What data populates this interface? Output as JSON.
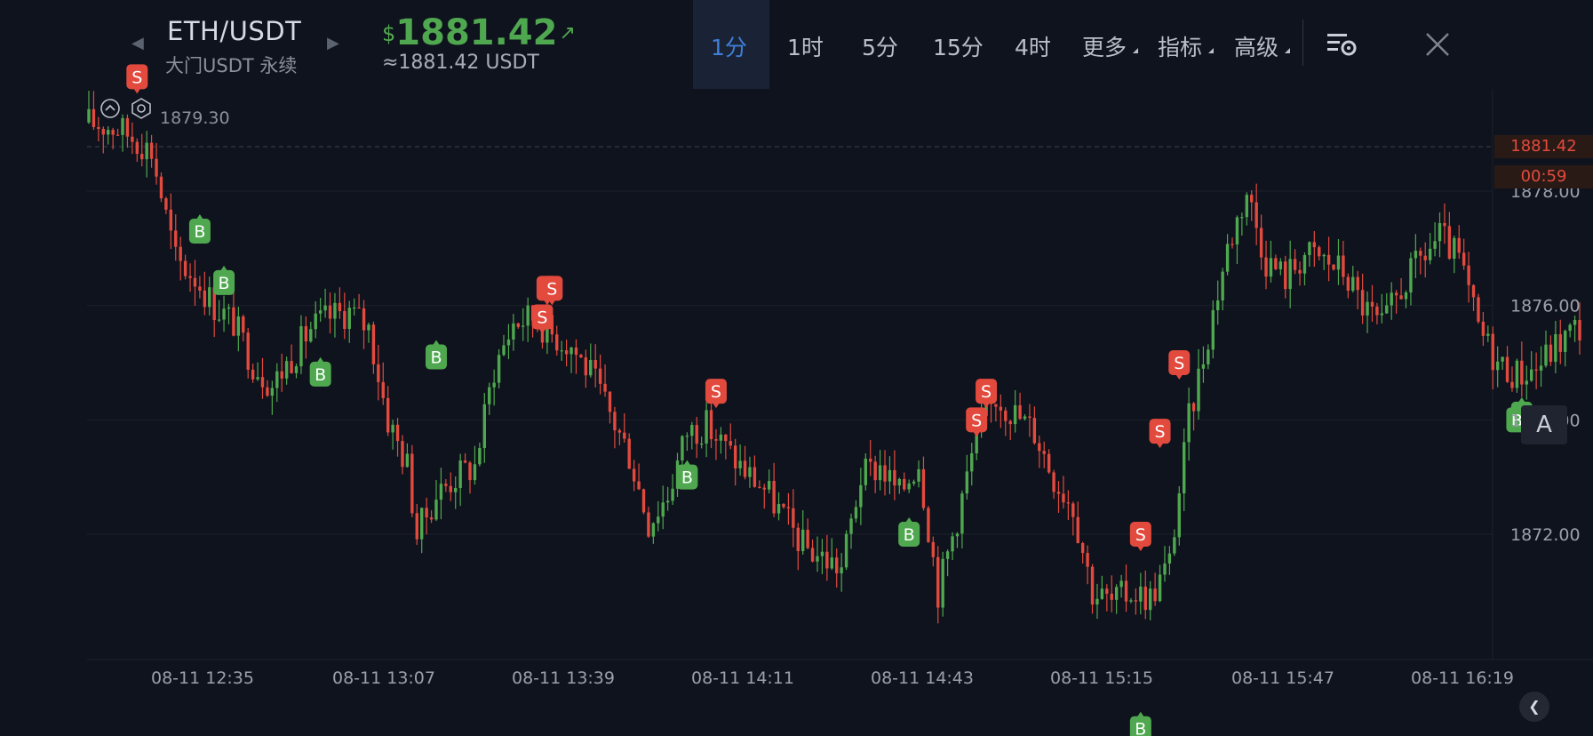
{
  "header": {
    "symbol": "ETH/USDT",
    "subtitle": "大门USDT 永续",
    "price_currency": "$",
    "price": "1881.42",
    "price_arrow": "↗",
    "price_sub": "≈1881.42 USDT",
    "timeframes": [
      "1分",
      "1时",
      "5分",
      "15分",
      "4时",
      "更多",
      "指标",
      "高级"
    ],
    "active_timeframe": "1分"
  },
  "price_label": "1881.42",
  "countdown_label": "00:59",
  "low_label": "1879.30",
  "a_button": "A",
  "back_button": "❮",
  "colors": {
    "up": "#4fa84f",
    "down": "#e24a3e",
    "background": "#0f131d",
    "accent": "#3f7fd8"
  },
  "icons": [
    "chevron-left-icon",
    "chevron-right-icon",
    "settings-list-icon",
    "close-icon",
    "collapse-icon",
    "eye-icon"
  ],
  "chart_data": {
    "type": "candlestick",
    "y_ticks": [
      "1878.00",
      "1876.00",
      "1874.00",
      "1872.00"
    ],
    "x_ticks": [
      "08-11 12:35",
      "08-11 13:07",
      "08-11 13:39",
      "08-11 14:11",
      "08-11 14:43",
      "08-11 15:15",
      "08-11 15:47",
      "08-11 16:19"
    ],
    "ylim": [
      1867.8,
      1880.2
    ],
    "current_price": 1881.42,
    "grid": "horizontal",
    "close_path": [
      [
        0,
        1879.2
      ],
      [
        6,
        1879.1
      ],
      [
        10,
        1878.9
      ],
      [
        13,
        1878.7
      ],
      [
        18,
        1876.8
      ],
      [
        22,
        1876.5
      ],
      [
        26,
        1876.0
      ],
      [
        30,
        1875.7
      ],
      [
        34,
        1875.0
      ],
      [
        38,
        1874.6
      ],
      [
        42,
        1875.1
      ],
      [
        46,
        1875.6
      ],
      [
        50,
        1875.8
      ],
      [
        54,
        1875.9
      ],
      [
        58,
        1875.6
      ],
      [
        62,
        1874.0
      ],
      [
        66,
        1873.2
      ],
      [
        68,
        1872.0
      ],
      [
        72,
        1872.7
      ],
      [
        76,
        1873.0
      ],
      [
        80,
        1873.2
      ],
      [
        84,
        1874.9
      ],
      [
        88,
        1875.7
      ],
      [
        92,
        1875.8
      ],
      [
        96,
        1875.5
      ],
      [
        100,
        1875.3
      ],
      [
        104,
        1874.8
      ],
      [
        108,
        1874.1
      ],
      [
        112,
        1873.4
      ],
      [
        116,
        1872.2
      ],
      [
        120,
        1872.7
      ],
      [
        124,
        1873.8
      ],
      [
        128,
        1873.9
      ],
      [
        132,
        1873.5
      ],
      [
        136,
        1873.1
      ],
      [
        140,
        1872.8
      ],
      [
        144,
        1872.3
      ],
      [
        148,
        1871.8
      ],
      [
        152,
        1871.6
      ],
      [
        156,
        1871.4
      ],
      [
        160,
        1873.0
      ],
      [
        164,
        1873.2
      ],
      [
        168,
        1872.7
      ],
      [
        172,
        1873.3
      ],
      [
        176,
        1871.0
      ],
      [
        180,
        1872.3
      ],
      [
        184,
        1873.7
      ],
      [
        188,
        1874.4
      ],
      [
        192,
        1874.1
      ],
      [
        196,
        1873.8
      ],
      [
        200,
        1873.0
      ],
      [
        204,
        1872.5
      ],
      [
        208,
        1871.0
      ],
      [
        212,
        1870.8
      ],
      [
        216,
        1871.0
      ],
      [
        220,
        1870.9
      ],
      [
        224,
        1871.5
      ],
      [
        228,
        1874.0
      ],
      [
        232,
        1875.5
      ],
      [
        236,
        1877.0
      ],
      [
        240,
        1878.0
      ],
      [
        244,
        1876.8
      ],
      [
        248,
        1876.5
      ],
      [
        252,
        1876.9
      ],
      [
        256,
        1876.8
      ],
      [
        260,
        1876.6
      ],
      [
        264,
        1876.0
      ],
      [
        268,
        1875.6
      ],
      [
        272,
        1876.3
      ],
      [
        276,
        1876.8
      ],
      [
        280,
        1877.2
      ],
      [
        284,
        1876.8
      ],
      [
        288,
        1875.6
      ],
      [
        292,
        1875.0
      ],
      [
        296,
        1874.8
      ],
      [
        300,
        1874.9
      ],
      [
        304,
        1875.3
      ],
      [
        308,
        1875.6
      ]
    ],
    "markers": [
      {
        "label": "S",
        "t": 10,
        "price": 1880.0
      },
      {
        "label": "B",
        "t": 23,
        "price": 1877.3
      },
      {
        "label": "B",
        "t": 28,
        "price": 1876.4
      },
      {
        "label": "B",
        "t": 48,
        "price": 1874.8
      },
      {
        "label": "B",
        "t": 72,
        "price": 1875.1
      },
      {
        "label": "S",
        "t": 95,
        "price": 1876.3
      },
      {
        "label": "S",
        "t": 96,
        "price": 1876.3
      },
      {
        "label": "S",
        "t": 94,
        "price": 1875.8
      },
      {
        "label": "S",
        "t": 130,
        "price": 1874.5
      },
      {
        "label": "B",
        "t": 124,
        "price": 1873.0
      },
      {
        "label": "B",
        "t": 170,
        "price": 1872.0
      },
      {
        "label": "S",
        "t": 186,
        "price": 1874.5
      },
      {
        "label": "S",
        "t": 184,
        "price": 1874.0
      },
      {
        "label": "S",
        "t": 218,
        "price": 1872.0
      },
      {
        "label": "B",
        "t": 218,
        "price": 1868.6
      },
      {
        "label": "S",
        "t": 226,
        "price": 1875.0
      },
      {
        "label": "S",
        "t": 222,
        "price": 1873.8
      },
      {
        "label": "B",
        "t": 297,
        "price": 1874.1
      },
      {
        "label": "B",
        "t": 296,
        "price": 1874.0
      }
    ]
  }
}
